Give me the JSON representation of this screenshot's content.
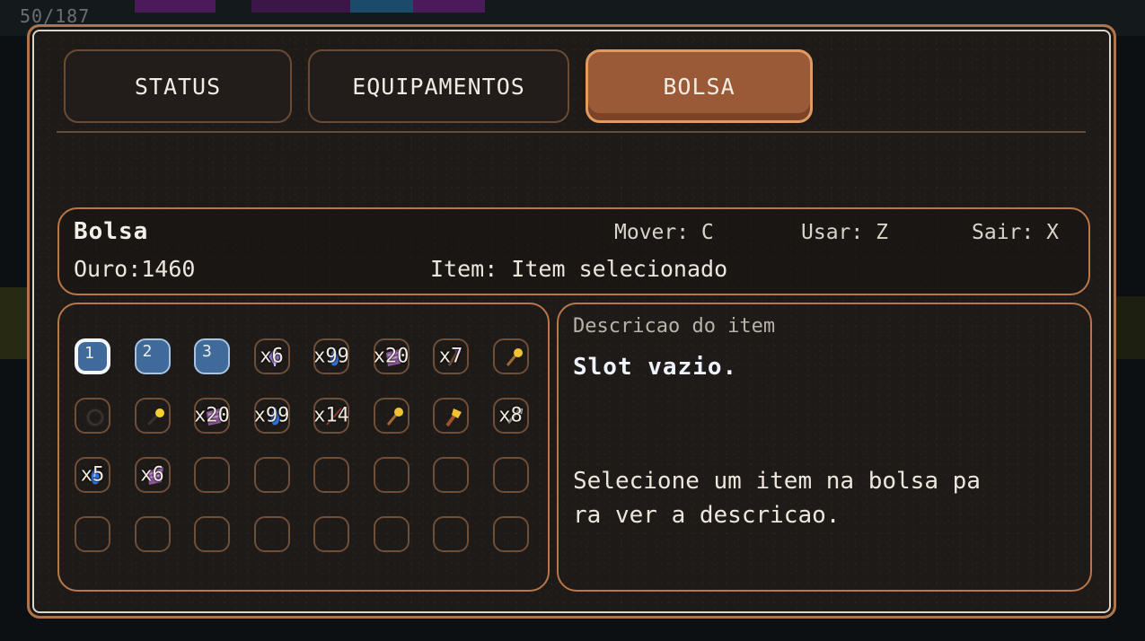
{
  "hud": {
    "counter": "50/187"
  },
  "tabs": [
    {
      "label": "STATUS",
      "active": false
    },
    {
      "label": "EQUIPAMENTOS",
      "active": false
    },
    {
      "label": "BOLSA",
      "active": true
    }
  ],
  "header": {
    "title": "Bolsa",
    "gold": "Ouro:1460",
    "item": "Item: Item selecionado",
    "hints": {
      "move": "Mover: C",
      "use": "Usar: Z",
      "exit": "Sair: X"
    }
  },
  "description": {
    "label": "Descricao do item",
    "name": "Slot vazio.",
    "text": "Selecione um item na bolsa pa\nra ver a descricao."
  },
  "slots": [
    {
      "hotkey": "1",
      "selected": true,
      "icon": "",
      "qty": ""
    },
    {
      "hotkey": "2",
      "selected": false,
      "icon": "",
      "qty": ""
    },
    {
      "hotkey": "3",
      "selected": false,
      "icon": "",
      "qty": ""
    },
    {
      "hotkey": "",
      "icon": "purple-crystal-icon",
      "qty": "x6"
    },
    {
      "hotkey": "",
      "icon": "blue-potion-icon",
      "qty": "x99"
    },
    {
      "hotkey": "",
      "icon": "purple-cloth-icon",
      "qty": "x20"
    },
    {
      "hotkey": "",
      "icon": "purple-axe-icon",
      "qty": "x7"
    },
    {
      "hotkey": "",
      "icon": "gold-staff-icon",
      "qty": ""
    },
    {
      "hotkey": "",
      "icon": "dark-ring-icon",
      "qty": ""
    },
    {
      "hotkey": "",
      "icon": "gold-wand-icon",
      "qty": ""
    },
    {
      "hotkey": "",
      "icon": "purple-cloth-icon",
      "qty": "x20"
    },
    {
      "hotkey": "",
      "icon": "blue-potion-icon",
      "qty": "x99"
    },
    {
      "hotkey": "",
      "icon": "red-arrow-icon",
      "qty": "x14"
    },
    {
      "hotkey": "",
      "icon": "gold-staff-icon",
      "qty": ""
    },
    {
      "hotkey": "",
      "icon": "gold-hammer-icon",
      "qty": ""
    },
    {
      "hotkey": "",
      "icon": "gray-bolt-icon",
      "qty": "x8"
    },
    {
      "hotkey": "",
      "icon": "blue-potion-icon",
      "qty": "x5"
    },
    {
      "hotkey": "",
      "icon": "purple-cloth-icon",
      "qty": "x6"
    },
    {
      "hotkey": "",
      "icon": "",
      "qty": ""
    },
    {
      "hotkey": "",
      "icon": "",
      "qty": ""
    },
    {
      "hotkey": "",
      "icon": "",
      "qty": ""
    },
    {
      "hotkey": "",
      "icon": "",
      "qty": ""
    },
    {
      "hotkey": "",
      "icon": "",
      "qty": ""
    },
    {
      "hotkey": "",
      "icon": "",
      "qty": ""
    },
    {
      "hotkey": "",
      "icon": "",
      "qty": ""
    },
    {
      "hotkey": "",
      "icon": "",
      "qty": ""
    },
    {
      "hotkey": "",
      "icon": "",
      "qty": ""
    },
    {
      "hotkey": "",
      "icon": "",
      "qty": ""
    },
    {
      "hotkey": "",
      "icon": "",
      "qty": ""
    },
    {
      "hotkey": "",
      "icon": "",
      "qty": ""
    },
    {
      "hotkey": "",
      "icon": "",
      "qty": ""
    },
    {
      "hotkey": "",
      "icon": "",
      "qty": ""
    }
  ]
}
